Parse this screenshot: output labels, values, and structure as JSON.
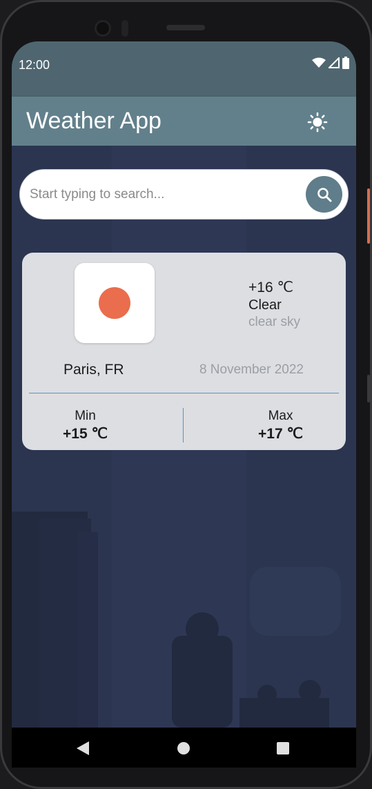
{
  "status_bar": {
    "time": "12:00",
    "icons": [
      "wifi-icon",
      "cell-signal-icon",
      "battery-icon"
    ]
  },
  "app_bar": {
    "title": "Weather App",
    "theme_icon": "sun-icon"
  },
  "search": {
    "placeholder": "Start typing to search...",
    "value": "",
    "button_icon": "search-icon"
  },
  "weather_card": {
    "icon": "clear-sky-sun-icon",
    "temperature": "+16 ℃",
    "condition": "Clear",
    "description": "clear sky",
    "city": "Paris, FR",
    "date": "8 November 2022",
    "min_label": "Min",
    "min_value": "+15 ℃",
    "max_label": "Max",
    "max_value": "+17 ℃"
  },
  "nav_bar": {
    "items": [
      "back-icon",
      "home-icon",
      "recents-icon"
    ]
  },
  "colors": {
    "status_bar": "#4f6670",
    "app_bar": "#62808b",
    "background": "#2b3550",
    "card": "#dcdee2",
    "accent": "#5f7d8a",
    "sun": "#ea6d4d",
    "divider": "#5f8fc0"
  }
}
